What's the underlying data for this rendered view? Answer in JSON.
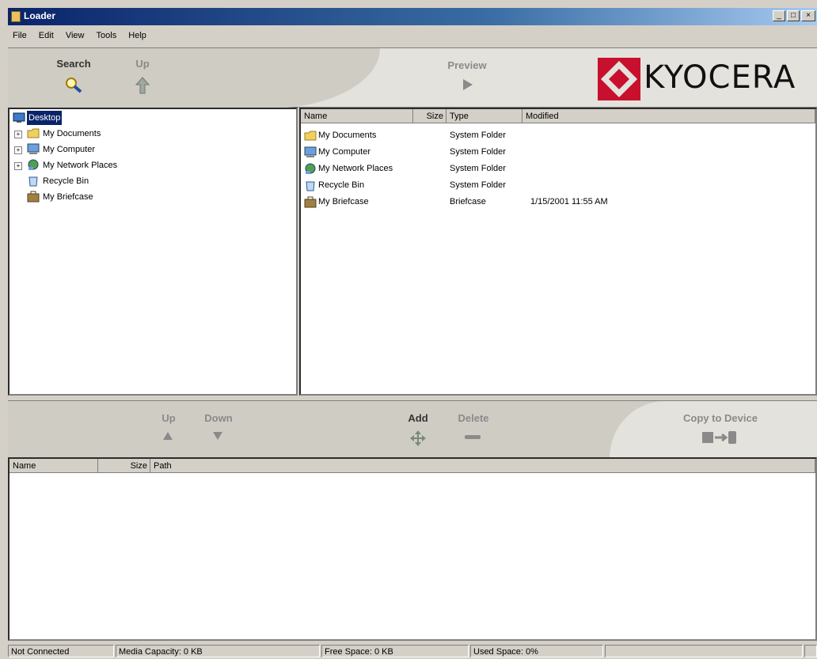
{
  "window": {
    "title": "Loader",
    "buttons": [
      "_",
      "□",
      "×"
    ]
  },
  "menu": [
    "File",
    "Edit",
    "View",
    "Tools",
    "Help"
  ],
  "toolbar_top": {
    "search": "Search",
    "up": "Up",
    "preview": "Preview",
    "logo": "KYOCERA"
  },
  "tree": {
    "root": "Desktop",
    "items": [
      "My Documents",
      "My Computer",
      "My Network Places",
      "Recycle Bin",
      "My Briefcase"
    ]
  },
  "file_list": {
    "columns": [
      "Name",
      "Size",
      "Type",
      "Modified"
    ],
    "rows": [
      {
        "name": "My Documents",
        "size": "",
        "type": "System Folder",
        "modified": ""
      },
      {
        "name": "My Computer",
        "size": "",
        "type": "System Folder",
        "modified": ""
      },
      {
        "name": "My Network Places",
        "size": "",
        "type": "System Folder",
        "modified": ""
      },
      {
        "name": "Recycle Bin",
        "size": "",
        "type": "System Folder",
        "modified": ""
      },
      {
        "name": "My Briefcase",
        "size": "",
        "type": "Briefcase",
        "modified": "1/15/2001 11:55 AM"
      }
    ]
  },
  "toolbar_bottom": {
    "up": "Up",
    "down": "Down",
    "add": "Add",
    "delete": "Delete",
    "copy": "Copy to Device"
  },
  "queue": {
    "columns": [
      "Name",
      "Size",
      "Path"
    ]
  },
  "status": {
    "connection": "Not Connected",
    "media_capacity": "Media Capacity: 0 KB",
    "free_space": "Free Space: 0 KB",
    "used_space": "Used Space:  0%",
    "progress": 0
  },
  "colors": {
    "title_bar": "#0a246a",
    "kyocera_red": "#c8102e",
    "face": "#d4d0c8"
  }
}
